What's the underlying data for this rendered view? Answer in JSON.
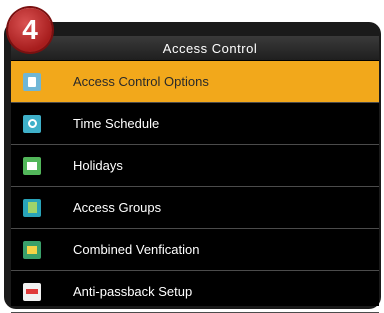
{
  "step_badge": "4",
  "title": "Access Control",
  "menu": [
    {
      "label": "Access Control Options",
      "icon": "access-options-icon",
      "selected": true
    },
    {
      "label": "Time Schedule",
      "icon": "time-schedule-icon",
      "selected": false
    },
    {
      "label": "Holidays",
      "icon": "holidays-icon",
      "selected": false
    },
    {
      "label": "Access Groups",
      "icon": "access-groups-icon",
      "selected": false
    },
    {
      "label": "Combined Venfication",
      "icon": "combined-verification-icon",
      "selected": false
    },
    {
      "label": "Anti-passback Setup",
      "icon": "anti-passback-icon",
      "selected": false
    }
  ],
  "colors": {
    "selected": "#f2a81b",
    "badge": "#a71d1d",
    "background": "#000000"
  }
}
